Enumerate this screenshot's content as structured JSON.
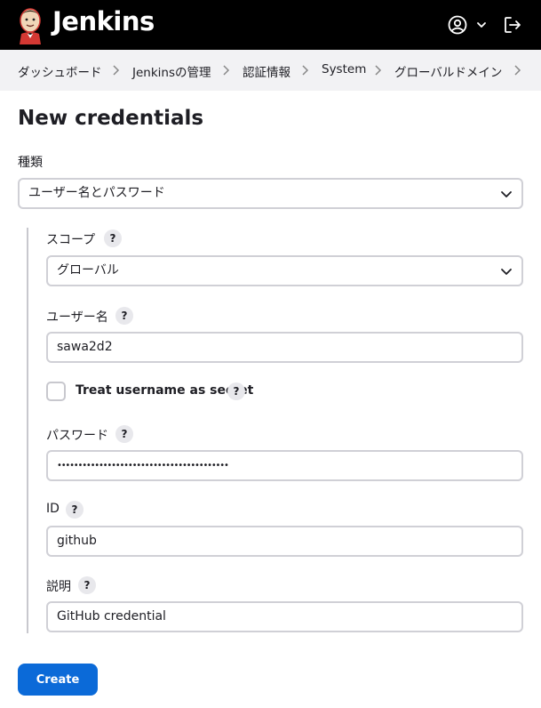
{
  "header": {
    "brand": "Jenkins",
    "icons": {
      "logo": "jenkins-butler-logo",
      "user": "user-circle-icon",
      "user_menu": "chevron-down-icon",
      "logout": "logout-icon"
    }
  },
  "breadcrumb": [
    "ダッシュボード",
    "Jenkinsの管理",
    "認証情報",
    "System",
    "グローバルドメイン"
  ],
  "page": {
    "title": "New credentials"
  },
  "form": {
    "kind": {
      "label": "種類",
      "value": "ユーザー名とパスワード"
    },
    "scope": {
      "label": "スコープ",
      "help": "?",
      "value": "グローバル"
    },
    "username": {
      "label": "ユーザー名",
      "help": "?",
      "value": "sawa2d2"
    },
    "treat_secret": {
      "label": "Treat username as secret",
      "help": "?",
      "checked": false
    },
    "password": {
      "label": "パスワード",
      "help": "?",
      "value": "•••••••••••••••••••••••••••••••••••••••••"
    },
    "id": {
      "label": "ID",
      "help": "?",
      "value": "github"
    },
    "description": {
      "label": "説明",
      "help": "?",
      "value": "GitHub credential"
    },
    "create_label": "Create"
  },
  "colors": {
    "header_bg": "#000000",
    "breadcrumb_bg": "#f2f2f4",
    "primary": "#0b6ad8",
    "border": "#d0d0d6"
  }
}
